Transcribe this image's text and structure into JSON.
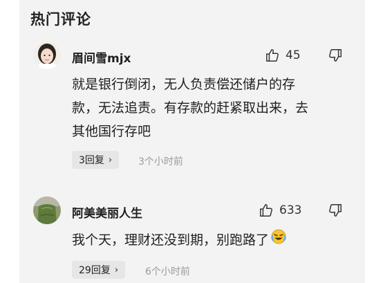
{
  "section": {
    "title": "热门评论"
  },
  "comments": [
    {
      "username": "眉间雪mjx",
      "likes": "45",
      "text_lines": [
        "就是银行倒闭，无人负责偿还储户的存",
        "款，无法追责。有存款的赶紧取出来，去",
        "其他国行存吧"
      ],
      "reply_label": "3回复",
      "reply_chevron": "›",
      "time": "3个小时前"
    },
    {
      "username": "阿美美丽人生",
      "likes": "633",
      "text_lines": [
        "我个天，理财还没到期，别跑路了"
      ],
      "reply_label": "29回复",
      "reply_chevron": "›",
      "time": "6个小时前"
    }
  ],
  "icons": {
    "like": "thumbs-up-icon",
    "dislike": "thumbs-down-icon",
    "emoji": "crying-laughing-emoji"
  },
  "colors": {
    "panel_bg": "#f3f3f3",
    "chip_bg": "#e6e6e6",
    "muted_text": "#9a9a9a"
  }
}
